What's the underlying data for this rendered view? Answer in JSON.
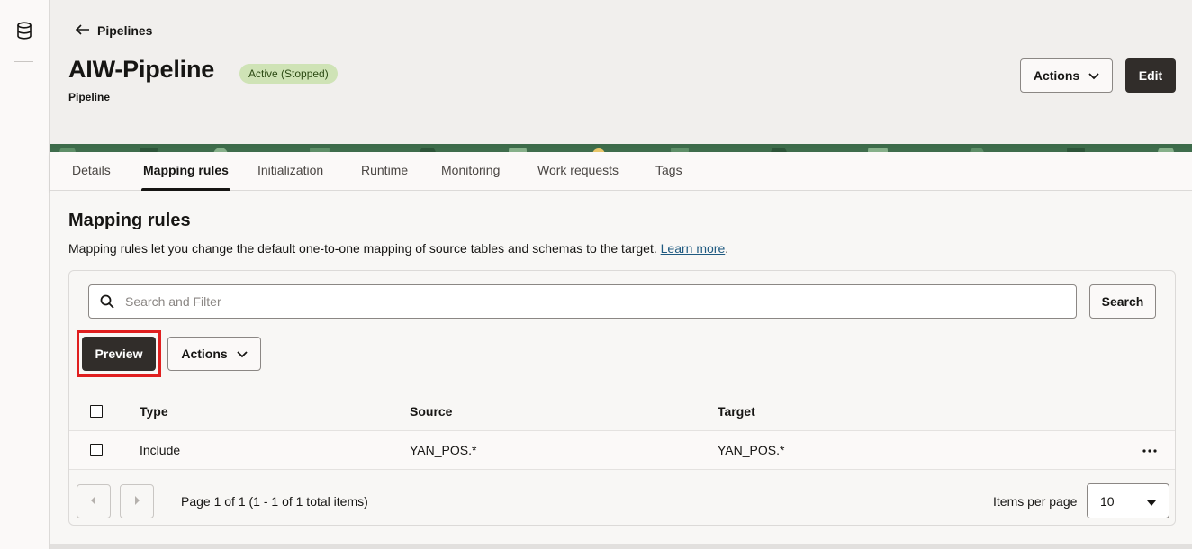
{
  "colors": {
    "primary_button": "#312d2a",
    "badge_bg": "#cfe3b6",
    "badge_text": "#2c4a13",
    "link": "#1f5a80",
    "highlight": "#e01f1f"
  },
  "rail": {
    "icon": "database-icon"
  },
  "header": {
    "back_label": "Pipelines",
    "title": "AIW-Pipeline",
    "status": "Active (Stopped)",
    "subtitle": "Pipeline",
    "actions_label": "Actions",
    "edit_label": "Edit"
  },
  "tabs": [
    {
      "label": "Details",
      "active": false
    },
    {
      "label": "Mapping rules",
      "active": true
    },
    {
      "label": "Initialization",
      "active": false
    },
    {
      "label": "Runtime",
      "active": false
    },
    {
      "label": "Monitoring",
      "active": false
    },
    {
      "label": "Work requests",
      "active": false
    },
    {
      "label": "Tags",
      "active": false
    }
  ],
  "section": {
    "title": "Mapping rules",
    "description": "Mapping rules let you change the default one-to-one mapping of source tables and schemas to the target.",
    "learn_more": "Learn more",
    "period": "."
  },
  "search": {
    "placeholder": "Search and Filter",
    "value": "",
    "button_label": "Search"
  },
  "toolbar": {
    "preview_label": "Preview",
    "actions_label": "Actions"
  },
  "table": {
    "columns": [
      "Type",
      "Source",
      "Target"
    ],
    "rows": [
      {
        "type": "Include",
        "source": "YAN_POS.*",
        "target": "YAN_POS.*"
      }
    ]
  },
  "pagination": {
    "text": "Page 1 of 1 (1 - 1 of 1 total items)",
    "items_per_page_label": "Items per page",
    "items_per_page": "10"
  }
}
